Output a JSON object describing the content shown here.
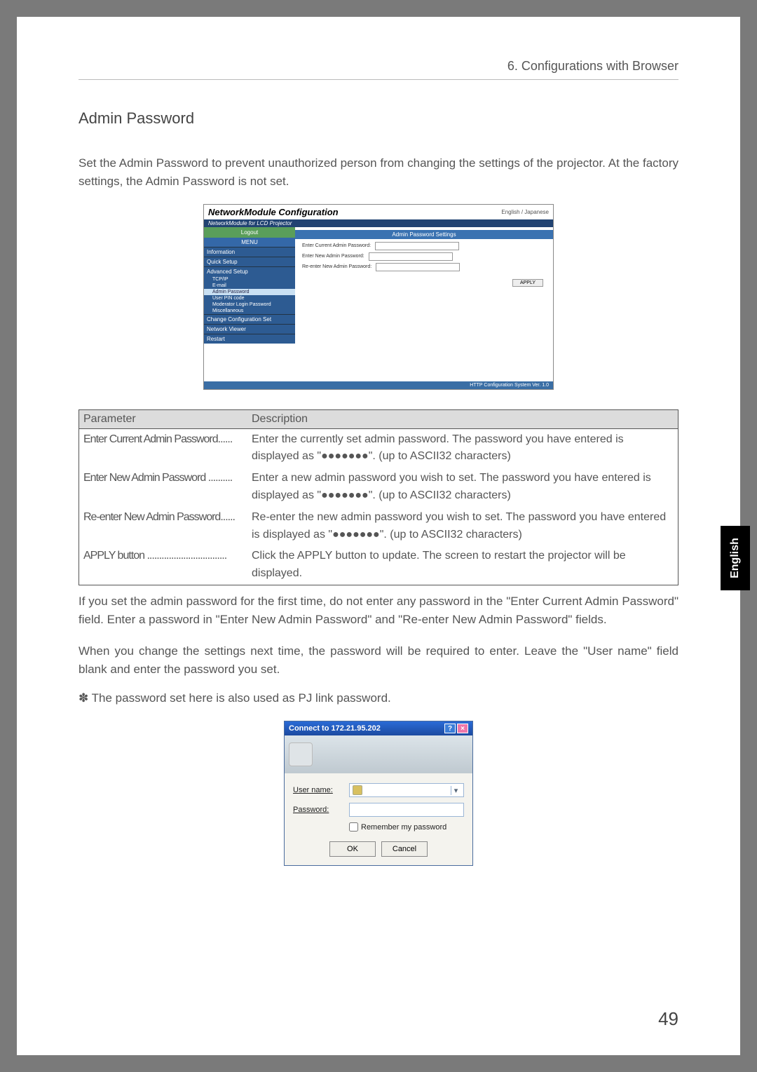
{
  "header": "6. Configurations with Browser",
  "h2": "Admin Password",
  "intro": "Set the Admin Password to prevent unauthorized person from changing the settings of the projector.  At the factory settings, the Admin Password is not set.",
  "netmod": {
    "title": "NetworkModule Configuration",
    "lang_button": "English / Japanese",
    "bar": "NetworkModule for LCD Projector",
    "logout": "Logout",
    "menu_label": "MENU",
    "nav_main": [
      "Information",
      "Quick Setup",
      "Advanced Setup"
    ],
    "nav_sub": [
      "TCP/IP",
      "E-mail",
      "Admin Password",
      "User PIN code",
      "Moderator Login Password",
      "Miscellaneous"
    ],
    "nav_bottom": [
      "Change Configuration Set",
      "Network Viewer",
      "Restart"
    ],
    "panel_title": "Admin Password Settings",
    "row1": "Enter Current Admin Password:",
    "row2": "Enter New Admin Password:",
    "row3": "Re-enter New Admin Password:",
    "apply": "APPLY",
    "footer": "HTTP Configuration System Ver. 1.0"
  },
  "param_head": {
    "c1": "Parameter",
    "c2": "Description"
  },
  "params": [
    {
      "c1": "Enter Current Admin Password......",
      "c2": "Enter the currently set admin password.  The password you have entered is displayed as \"●●●●●●●\".  (up to ASCII32 characters)"
    },
    {
      "c1": "Enter New Admin Password ..........",
      "c2": "Enter a new admin password you wish to set.  The password you have entered is displayed as \"●●●●●●●\".   (up to ASCII32 characters)"
    },
    {
      "c1": "Re-enter New Admin Password......",
      "c2": "Re-enter the new admin password you wish to set. The password you have entered is displayed as \"●●●●●●●\".  (up to ASCII32 characters)"
    },
    {
      "c1": "APPLY button .................................",
      "c2": "Click the APPLY button to update. The screen to restart the projector will be displayed."
    }
  ],
  "after1": "If you set the admin password for the first time, do not enter any password in the \"Enter Current Admin Password\" field.  Enter a password in \"Enter New Admin Password\" and \"Re-enter New Admin Password\" fields.",
  "after2": "When you change the settings next time, the password will be required to enter. Leave the \"User name\" field blank and enter the password you set.",
  "note": "✽ The password set here is also used as PJ link password.",
  "dlg": {
    "title": "Connect to 172.21.95.202",
    "user_label": "User name:",
    "pass_label": "Password:",
    "remember": "Remember my password",
    "ok": "OK",
    "cancel": "Cancel"
  },
  "side": "English",
  "pagenum": "49"
}
